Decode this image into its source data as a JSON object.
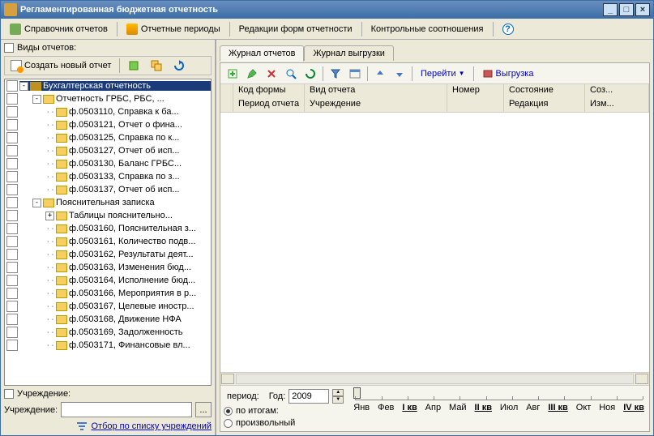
{
  "window": {
    "title": "Регламентированная бюджетная отчетность"
  },
  "menu": {
    "reference": "Справочник отчетов",
    "periods": "Отчетные периоды",
    "editions": "Редакции форм отчетности",
    "control": "Контрольные соотношения",
    "help": "?"
  },
  "left": {
    "types_label": "Виды отчетов:",
    "create": "Создать новый отчет",
    "org_chk_label": "Учреждение:",
    "org_label": "Учреждение:",
    "filter_link": "Отбор по списку учреждений"
  },
  "tree": [
    {
      "lvl": 0,
      "exp": "-",
      "sel": true,
      "fold": "dark",
      "txt": "Бухгалтерская отчетность"
    },
    {
      "lvl": 1,
      "exp": "-",
      "fold": "light",
      "txt": "Отчетность ГРБС, РБС, ..."
    },
    {
      "lvl": 2,
      "fold": "light",
      "txt": "ф.0503110, Справка к ба..."
    },
    {
      "lvl": 2,
      "fold": "light",
      "txt": "ф.0503121, Отчет о фина..."
    },
    {
      "lvl": 2,
      "fold": "light",
      "txt": "ф.0503125, Справка по к..."
    },
    {
      "lvl": 2,
      "fold": "light",
      "txt": "ф.0503127, Отчет об исп..."
    },
    {
      "lvl": 2,
      "fold": "light",
      "txt": "ф.0503130, Баланс ГРБС..."
    },
    {
      "lvl": 2,
      "fold": "light",
      "txt": "ф.0503133, Справка по з..."
    },
    {
      "lvl": 2,
      "fold": "light",
      "txt": "ф.0503137, Отчет об исп..."
    },
    {
      "lvl": 1,
      "exp": "-",
      "fold": "light",
      "txt": "Пояснительная записка"
    },
    {
      "lvl": 2,
      "exp": "+",
      "fold": "light",
      "txt": "Таблицы пояснительно..."
    },
    {
      "lvl": 2,
      "fold": "light",
      "txt": "ф.0503160, Пояснительная з..."
    },
    {
      "lvl": 2,
      "fold": "light",
      "txt": "ф.0503161, Количество подв..."
    },
    {
      "lvl": 2,
      "fold": "light",
      "txt": "ф.0503162, Результаты деят..."
    },
    {
      "lvl": 2,
      "fold": "light",
      "txt": "ф.0503163, Изменения бюд..."
    },
    {
      "lvl": 2,
      "fold": "light",
      "txt": "ф.0503164, Исполнение бюд..."
    },
    {
      "lvl": 2,
      "fold": "light",
      "txt": "ф.0503166, Мероприятия в р..."
    },
    {
      "lvl": 2,
      "fold": "light",
      "txt": "ф.0503167, Целевые иностр..."
    },
    {
      "lvl": 2,
      "fold": "light",
      "txt": "ф.0503168, Движение НФА"
    },
    {
      "lvl": 2,
      "fold": "light",
      "txt": "ф.0503169, Задолженность"
    },
    {
      "lvl": 2,
      "fold": "light",
      "txt": "ф.0503171, Финансовые вл..."
    }
  ],
  "tabs": {
    "journal": "Журнал отчетов",
    "export": "Журнал выгрузки"
  },
  "rtool": {
    "goto": "Перейти",
    "export": "Выгрузка"
  },
  "grid": {
    "r1": {
      "c1": "Код формы",
      "c2": "Вид отчета",
      "c3": "Номер",
      "c4": "Состояние",
      "c5": "Соз..."
    },
    "r2": {
      "c1": "Период отчета",
      "c2": "Учреждение",
      "c3": "",
      "c4": "Редакция",
      "c5": "Изм..."
    }
  },
  "bottom": {
    "period_chk": "период:",
    "year_lbl": "Год:",
    "year_val": "2009",
    "opt_results": "по итогам:",
    "opt_custom": "произвольный",
    "months": [
      "Янв",
      "Фев",
      "I кв",
      "Апр",
      "Май",
      "II кв",
      "Июл",
      "Авг",
      "III кв",
      "Окт",
      "Ноя",
      "IV кв"
    ],
    "bold_idx": [
      2,
      5,
      8,
      11
    ]
  }
}
